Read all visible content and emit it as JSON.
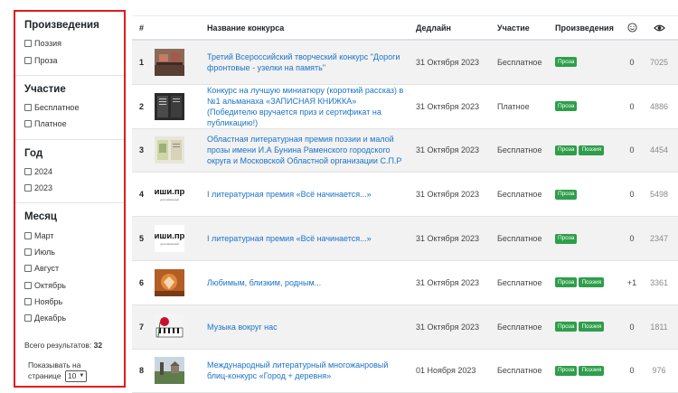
{
  "sidebar": {
    "works": {
      "title": "Произведения",
      "options": [
        "Поэзия",
        "Проза"
      ]
    },
    "participation": {
      "title": "Участие",
      "options": [
        "Бесплатное",
        "Платное"
      ]
    },
    "year": {
      "title": "Год",
      "options": [
        "2024",
        "2023"
      ]
    },
    "month": {
      "title": "Месяц",
      "options": [
        "Март",
        "Июль",
        "Август",
        "Октябрь",
        "Ноябрь",
        "Декабрь"
      ]
    },
    "total_label": "Всего результатов:",
    "total_value": "32",
    "perpage_label_1": "Показывать на",
    "perpage_label_2": "странице",
    "perpage_value": "10"
  },
  "table": {
    "headers": {
      "num": "#",
      "title": "Название конкурса",
      "deadline": "Дедлайн",
      "participation": "Участие",
      "works": "Произведения",
      "smile": "smile-icon",
      "views": "eye-icon"
    },
    "rows": [
      {
        "num": "1",
        "thumb": "photo-wall",
        "title": "Третий Всероссийский творческий конкурс \"Дороги фронтовые - узелки на память\"",
        "deadline": "31 Октября 2023",
        "participation": "Бесплатное",
        "badges": [
          "Проза"
        ],
        "likes": "0",
        "views": "7025"
      },
      {
        "num": "2",
        "thumb": "photo-board",
        "title": "Конкурс на лучшую миниатюру (короткий рассказ) в №1 альманаха «ЗАПИСНАЯ КНИЖКА» (Победителю вручается приз и сертификат на публикацию!)",
        "deadline": "31 Октября 2023",
        "participation": "Платное",
        "badges": [
          "Проза"
        ],
        "likes": "0",
        "views": "4886"
      },
      {
        "num": "3",
        "thumb": "photo-document",
        "title": "Областная литературная премия поэзии и малой прозы имени И.А Бунина Раменского городского округа и Московской Областной организации С.П.Р",
        "deadline": "31 Октября 2023",
        "participation": "Бесплатное",
        "badges": [
          "Проза",
          "Поэзия"
        ],
        "likes": "0",
        "views": "4454"
      },
      {
        "num": "4",
        "thumb": "pishi-pro-logo",
        "logo_text": "пиши.про",
        "logo_sub": "для писателей",
        "title": "I литературная премия «Всё начинается...»",
        "deadline": "31 Октября 2023",
        "participation": "Бесплатное",
        "badges": [
          "Проза"
        ],
        "likes": "0",
        "views": "5498"
      },
      {
        "num": "5",
        "thumb": "pishi-pro-logo",
        "logo_text": "пиши.про",
        "logo_sub": "для писателей",
        "title": "I литературная премия «Всё начинается...»",
        "deadline": "31 Октября 2023",
        "participation": "Бесплатное",
        "badges": [
          "Проза"
        ],
        "likes": "0",
        "views": "2347"
      },
      {
        "num": "6",
        "thumb": "photo-autumn",
        "title": "Любимым, близким, родным...",
        "deadline": "31 Октября 2023",
        "participation": "Бесплатное",
        "badges": [
          "Проза",
          "Поэзия"
        ],
        "likes": "+1",
        "views": "3361"
      },
      {
        "num": "7",
        "thumb": "photo-piano",
        "title": "Музыка вокруг нас",
        "deadline": "31 Октября 2023",
        "participation": "Бесплатное",
        "badges": [
          "Проза",
          "Поэзия"
        ],
        "likes": "0",
        "views": "1811"
      },
      {
        "num": "8",
        "thumb": "photo-landscape",
        "title": "Международный литературный многожанровый блиц-конкурс «Город + деревня»",
        "deadline": "01 Ноября 2023",
        "participation": "Бесплатное",
        "badges": [
          "Проза",
          "Поэзия"
        ],
        "likes": "0",
        "views": "976"
      }
    ]
  },
  "colors": {
    "highlight_border": "#e01c1c",
    "link": "#1a73c9",
    "badge": "#2e9e4a",
    "alt_row": "#f2f2f2"
  }
}
